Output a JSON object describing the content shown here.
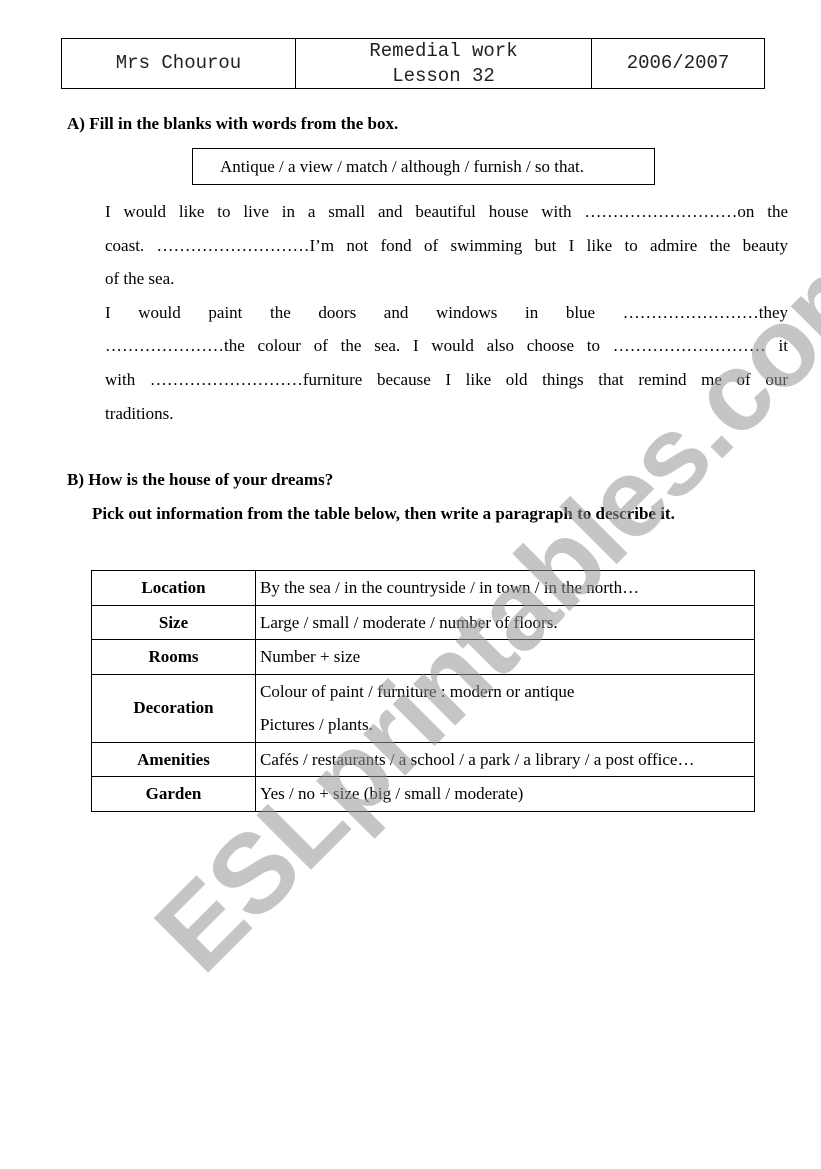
{
  "header": {
    "teacher": "Mrs Chourou",
    "title_line1": "Remedial work",
    "title_line2": "Lesson 32",
    "year": "2006/2007"
  },
  "section_a": {
    "title": "A) Fill in the blanks with words from the box.",
    "word_box": "Antique / a view / match / although / furnish / so that.",
    "paragraph_lines": [
      "I would like to live in a small and beautiful house with ………………………on the",
      "coast. ………………………I’m not fond of swimming but I like to admire the beauty",
      "of the sea.",
      "I would paint the doors and windows in blue ……………………they",
      "…………………the colour of  the sea. I would also choose to ……………………… it",
      "with ………………………furniture because I like old things that remind me of our",
      "traditions."
    ]
  },
  "section_b": {
    "title": "B) How is the house of your dreams?",
    "instruction": "Pick out information from the table below, then write a paragraph to describe it.",
    "table": [
      {
        "label": "Location",
        "lines": [
          "By the sea / in the countryside / in town / in the north…"
        ]
      },
      {
        "label": "Size",
        "lines": [
          "Large / small / moderate / number of floors."
        ]
      },
      {
        "label": "Rooms",
        "lines": [
          "Number + size"
        ]
      },
      {
        "label": "Decoration",
        "lines": [
          "Colour of paint / furniture : modern or antique",
          "Pictures / plants."
        ]
      },
      {
        "label": "Amenities",
        "lines": [
          "Cafés / restaurants / a school / a park / a library / a post office…"
        ]
      },
      {
        "label": "Garden",
        "lines": [
          "Yes / no + size (big / small / moderate)"
        ]
      }
    ]
  },
  "watermark": "ESLprintables.com"
}
